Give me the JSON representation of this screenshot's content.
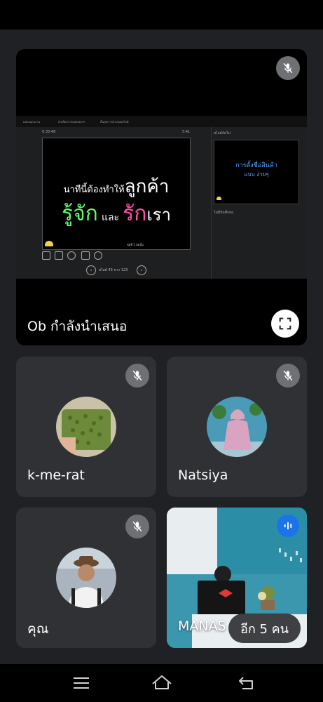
{
  "presentation": {
    "presenter_label": "Ob กำลังนำเสนอ",
    "slide": {
      "line1_small": "นาทีนี้ต้องทำให้",
      "line1_big": "ลูกค้า",
      "line2_a": "รู้จัก",
      "line2_b": "และ",
      "line2_c": "รัก",
      "line2_d": "เรา",
      "footer_note": "ชุดที่ 1 นัดนั้น",
      "time_left": "0:33:48",
      "time_right": "5:41",
      "slide_counter": "สไลด์ 43 จาก 123"
    },
    "thumb": {
      "header": "สไลด์ถัดไป",
      "line1": "การตั้งชื่อสินค้า",
      "line2": "แบบ ง่ายๆ",
      "notes_label": "ไม่มีบันทึกย่อ"
    },
    "window_menu": [
      "แสดงแถบงาน",
      "ตัวเลือกการแสดงผล ▾",
      "สิ้นสุดการนำเสนอสไลด์"
    ]
  },
  "participants": [
    {
      "name": "k-me-rat",
      "muted": true
    },
    {
      "name": "Natsiya",
      "muted": true
    },
    {
      "name": "คุณ",
      "muted": true
    },
    {
      "name": "MANAS",
      "speaking": true
    }
  ],
  "more_chip": "อีก 5 คน",
  "colors": {
    "background": "#202124",
    "tile": "#303134",
    "slide_pink": "#ff4fa8",
    "slide_green": "#5cff6e",
    "speaking_blue": "#1a73e8",
    "thumb_blue": "#5aa9ff"
  }
}
